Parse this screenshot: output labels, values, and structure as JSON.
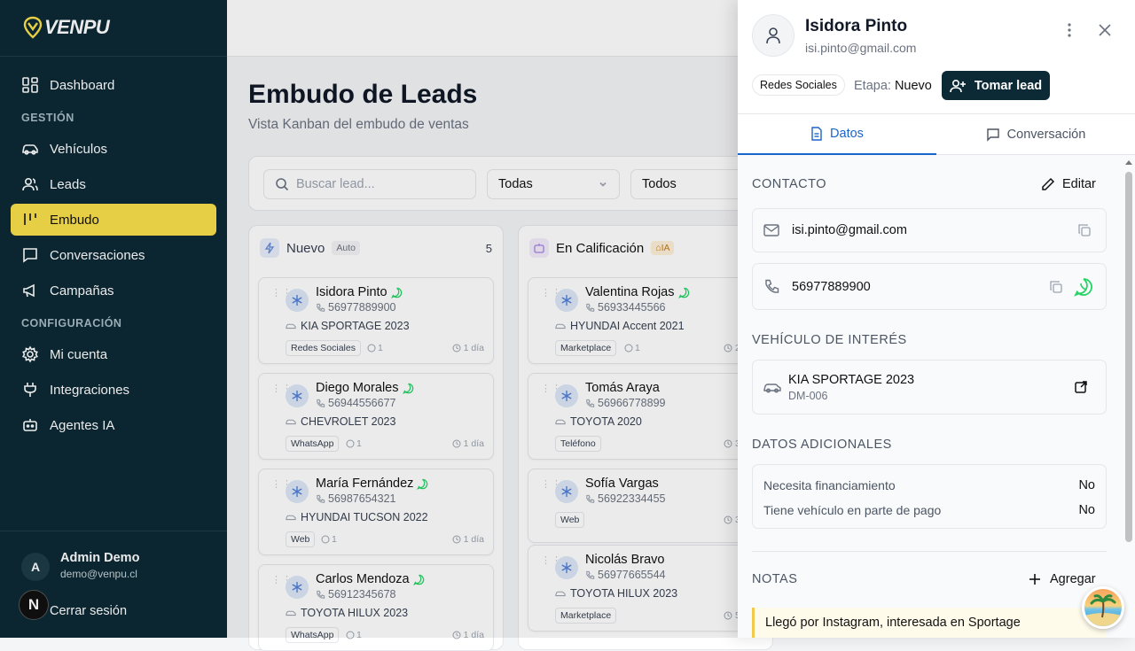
{
  "brand": {
    "name": "VENPU"
  },
  "sidebar": {
    "items": [
      {
        "label": "Dashboard"
      },
      {
        "section": "GESTIÓN"
      },
      {
        "label": "Vehículos"
      },
      {
        "label": "Leads"
      },
      {
        "label": "Embudo",
        "active": true
      },
      {
        "label": "Conversaciones"
      },
      {
        "label": "Campañas"
      },
      {
        "section": "CONFIGURACIÓN"
      },
      {
        "label": "Mi cuenta"
      },
      {
        "label": "Integraciones"
      },
      {
        "label": "Agentes IA"
      }
    ],
    "user": {
      "initial": "A",
      "name": "Admin Demo",
      "email": "demo@venpu.cl"
    },
    "logout": "Cerrar sesión",
    "badge": "N"
  },
  "main": {
    "title": "Embudo de Leads",
    "subtitle": "Vista Kanban del embudo de ventas",
    "search_placeholder": "Buscar lead...",
    "filter1": "Todas",
    "filter2": "Todos",
    "columns": [
      {
        "name": "Nuevo",
        "tag": "Auto",
        "count": "5",
        "cards": [
          {
            "name": "Isidora Pinto",
            "phone": "56977889900",
            "vehicle": "KIA SPORTAGE 2023",
            "source": "Redes Sociales",
            "comments": "1",
            "time": "1 día"
          },
          {
            "name": "Diego Morales",
            "phone": "56944556677",
            "vehicle": "CHEVROLET 2023",
            "source": "WhatsApp",
            "comments": "1",
            "time": "1 día"
          },
          {
            "name": "María Fernández",
            "phone": "56987654321",
            "vehicle": "HYUNDAI TUCSON 2022",
            "source": "Web",
            "comments": "1",
            "time": "1 día"
          },
          {
            "name": "Carlos Mendoza",
            "phone": "56912345678",
            "vehicle": "TOYOTA HILUX 2023",
            "source": "WhatsApp",
            "comments": "1",
            "time": "1 día"
          }
        ]
      },
      {
        "name": "En Calificación",
        "tag": "IA",
        "cards": [
          {
            "name": "Valentina Rojas",
            "phone": "56933445566",
            "vehicle": "HYUNDAI Accent 2021",
            "source": "Marketplace",
            "comments": "1",
            "time": "2"
          },
          {
            "name": "Tomás Araya",
            "phone": "56966778899",
            "vehicle": "TOYOTA 2020",
            "source": "Teléfono",
            "time": "3"
          },
          {
            "name": "Sofía Vargas",
            "phone": "56922334455",
            "source": "Web",
            "time": "3"
          },
          {
            "name": "Nicolás Bravo",
            "phone": "56977665544",
            "vehicle": "TOYOTA HILUX 2023",
            "source": "Marketplace",
            "time": "5"
          }
        ]
      }
    ]
  },
  "panel": {
    "name": "Isidora Pinto",
    "email": "isi.pinto@gmail.com",
    "source": "Redes Sociales",
    "stage_label": "Etapa:",
    "stage_value": "Nuevo",
    "take_button": "Tomar lead",
    "tabs": [
      "Datos",
      "Conversación"
    ],
    "contact": {
      "title": "CONTACTO",
      "edit": "Editar",
      "email": "isi.pinto@gmail.com",
      "phone": "56977889900"
    },
    "vehicle": {
      "title": "VEHÍCULO DE INTERÉS",
      "name": "KIA SPORTAGE 2023",
      "code": "DM-006"
    },
    "additional": {
      "title": "DATOS ADICIONALES",
      "rows": [
        {
          "label": "Necesita financiamiento",
          "value": "No"
        },
        {
          "label": "Tiene vehículo en parte de pago",
          "value": "No"
        }
      ]
    },
    "notes": {
      "title": "NOTAS",
      "add": "Agregar",
      "items": [
        "Llegó por Instagram, interesada en Sportage"
      ]
    }
  },
  "colors": {
    "sidebar_bg": "#0c2a36",
    "active_nav": "#fbe14b",
    "accent_blue": "#1d64c8",
    "whatsapp": "#25d366"
  }
}
